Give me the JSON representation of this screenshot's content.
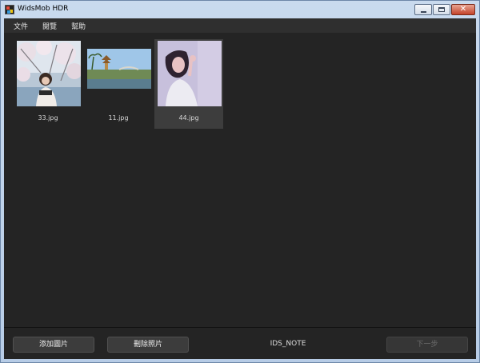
{
  "window": {
    "title": "WidsMob HDR"
  },
  "menu": {
    "items": [
      {
        "label": "文件"
      },
      {
        "label": "閱覽"
      },
      {
        "label": "幫助"
      }
    ]
  },
  "gallery": {
    "items": [
      {
        "filename": "33.jpg",
        "selected": false
      },
      {
        "filename": "11.jpg",
        "selected": false
      },
      {
        "filename": "44.jpg",
        "selected": true
      }
    ]
  },
  "footer": {
    "add_label": "添加圖片",
    "delete_label": "刪除照片",
    "note_text": "IDS_NOTE",
    "next_label": "下一步"
  },
  "colors": {
    "background": "#242424",
    "menubar": "#2f2f2f",
    "selection": "#3d3d3d"
  }
}
